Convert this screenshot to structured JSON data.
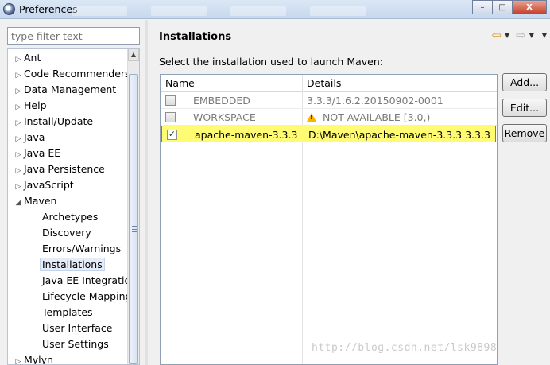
{
  "window": {
    "title": "Preferences",
    "min_label": "–",
    "max_label": "□",
    "close_label": "X"
  },
  "left": {
    "filter_placeholder": "type filter text",
    "tree": [
      {
        "label": "Ant",
        "arrow": "▷",
        "indent": 0
      },
      {
        "label": "Code Recommenders",
        "arrow": "▷",
        "indent": 0
      },
      {
        "label": "Data Management",
        "arrow": "▷",
        "indent": 0
      },
      {
        "label": "Help",
        "arrow": "▷",
        "indent": 0
      },
      {
        "label": "Install/Update",
        "arrow": "▷",
        "indent": 0
      },
      {
        "label": "Java",
        "arrow": "▷",
        "indent": 0
      },
      {
        "label": "Java EE",
        "arrow": "▷",
        "indent": 0
      },
      {
        "label": "Java Persistence",
        "arrow": "▷",
        "indent": 0
      },
      {
        "label": "JavaScript",
        "arrow": "▷",
        "indent": 0
      },
      {
        "label": "Maven",
        "arrow": "◢",
        "indent": 0
      },
      {
        "label": "Archetypes",
        "arrow": "",
        "indent": 1
      },
      {
        "label": "Discovery",
        "arrow": "",
        "indent": 1
      },
      {
        "label": "Errors/Warnings",
        "arrow": "",
        "indent": 1
      },
      {
        "label": "Installations",
        "arrow": "",
        "indent": 1,
        "selected": true
      },
      {
        "label": "Java EE Integration",
        "arrow": "",
        "indent": 1
      },
      {
        "label": "Lifecycle Mappings",
        "arrow": "",
        "indent": 1
      },
      {
        "label": "Templates",
        "arrow": "",
        "indent": 1
      },
      {
        "label": "User Interface",
        "arrow": "",
        "indent": 1
      },
      {
        "label": "User Settings",
        "arrow": "",
        "indent": 1
      },
      {
        "label": "Mylyn",
        "arrow": "▷",
        "indent": 0
      }
    ]
  },
  "page": {
    "title": "Installations",
    "instructions": "Select the installation used to launch Maven:",
    "nav": {
      "back": "⇦",
      "forward": "⇨",
      "dropdown": "▼"
    }
  },
  "table": {
    "columns": [
      "Name",
      "Details"
    ],
    "rows": [
      {
        "checked": false,
        "name": "EMBEDDED",
        "details": "3.3.3/1.6.2.20150902-0001",
        "muted": true,
        "warning": false
      },
      {
        "checked": false,
        "name": "WORKSPACE",
        "details": "NOT AVAILABLE [3.0,)",
        "muted": true,
        "warning": true
      },
      {
        "checked": true,
        "name": "apache-maven-3.3.3",
        "details": "D:\\Maven\\apache-maven-3.3.3 3.3.3",
        "muted": false,
        "warning": false,
        "selected": true
      }
    ]
  },
  "buttons": {
    "add": "Add...",
    "edit": "Edit...",
    "remove": "Remove"
  },
  "watermark": "http://blog.csdn.net/lsk9898",
  "colors": {
    "selection_highlight": "#fffb72",
    "warning": "#f4b400",
    "title_bar": "#c7d8ee"
  }
}
